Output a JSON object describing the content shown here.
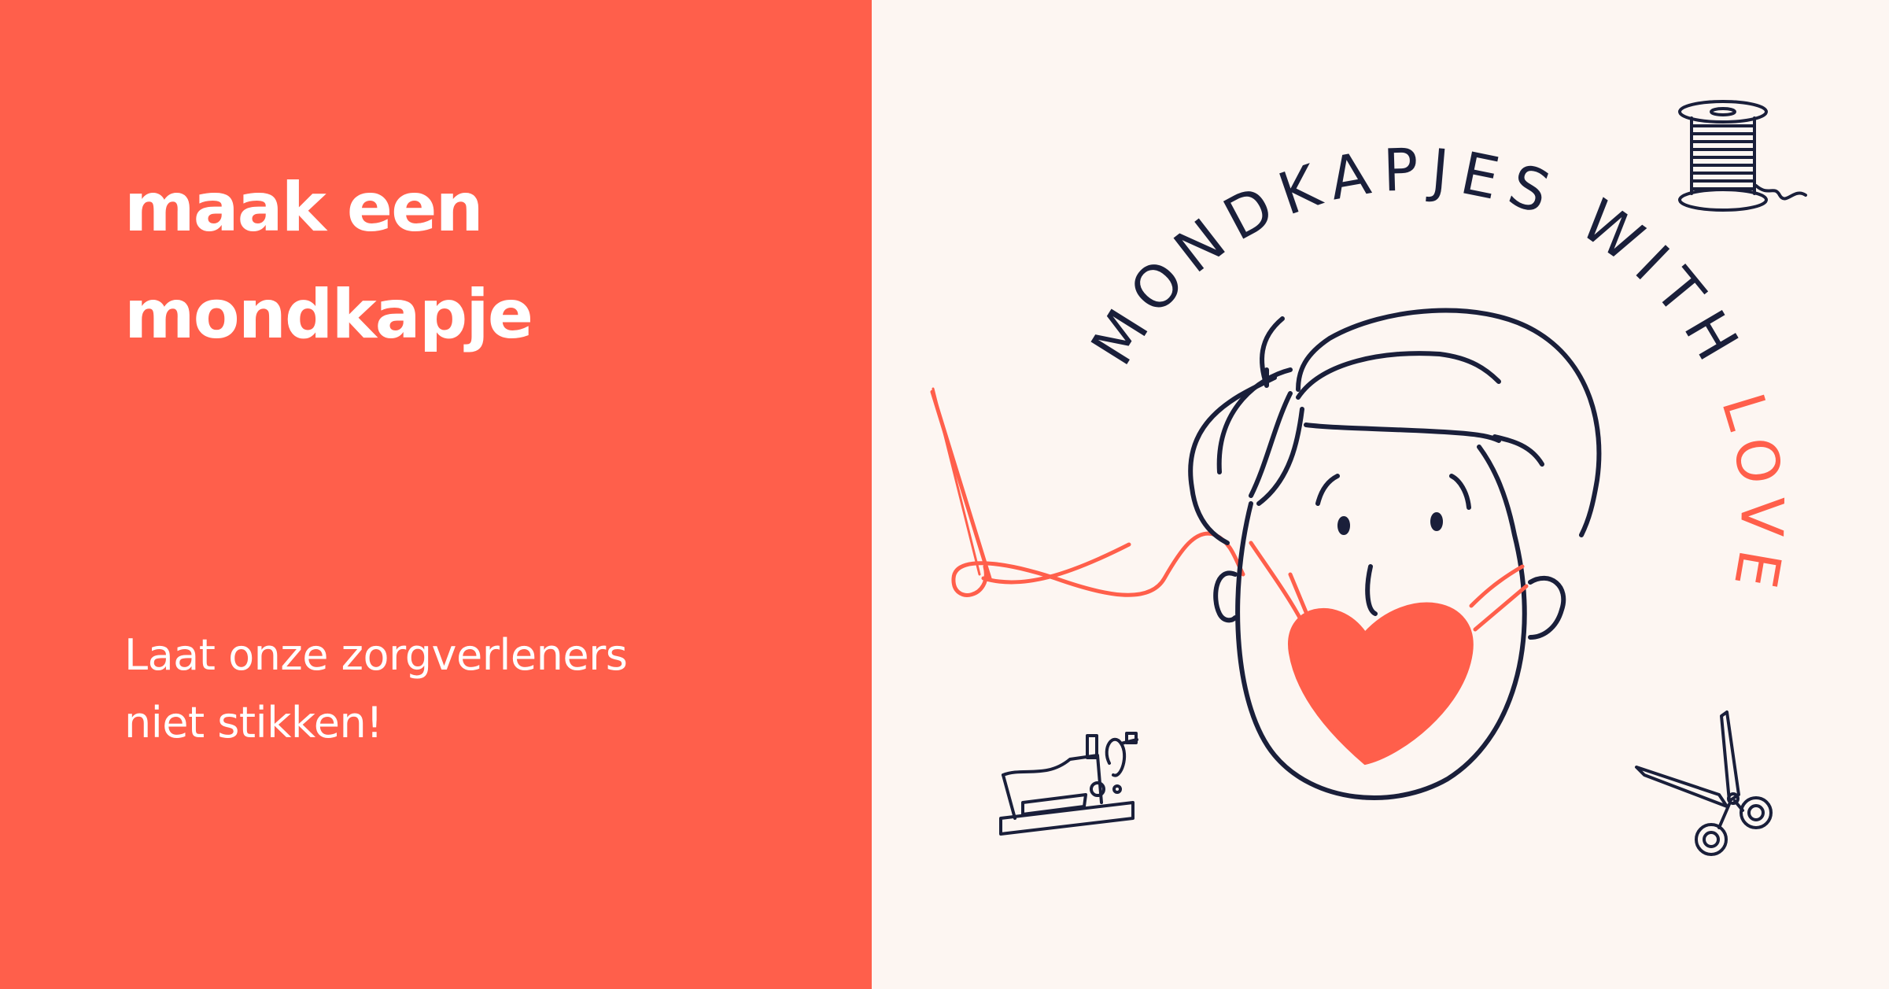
{
  "headline": {
    "line1": "maak een",
    "line2": "mondkapje"
  },
  "tagline": {
    "line1": "Laat onze zorgverleners",
    "line2": "niet stikken!"
  },
  "logo": {
    "text_main": "MONDKAPJES WITH ",
    "text_accent": "LOVE"
  },
  "colors": {
    "coral": "#ff5f4b",
    "navy": "#1a1f3a",
    "cream": "#fdf6f2",
    "white": "#ffffff"
  },
  "icons": [
    "needle-thread-icon",
    "thread-spool-icon",
    "sewing-machine-icon",
    "scissors-icon",
    "face-with-heart-mask-illustration"
  ]
}
